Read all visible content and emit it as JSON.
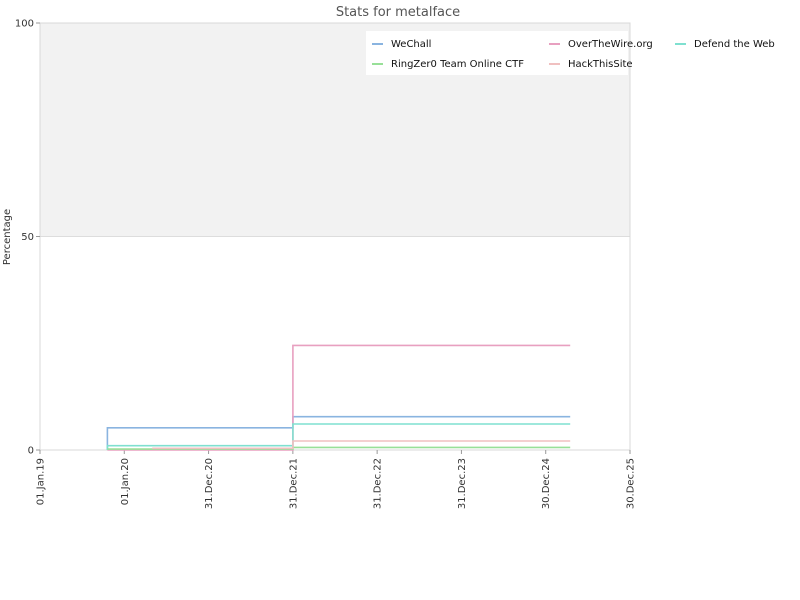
{
  "chart_data": {
    "type": "line",
    "title": "Stats for metalface",
    "ylabel": "Percentage",
    "xlabel": "",
    "ylim": [
      0,
      100
    ],
    "xlim": [
      "2019-01-01",
      "2025-12-30"
    ],
    "y_ticks": [
      0,
      50,
      100
    ],
    "x_ticks": [
      {
        "date": "2019-01-01",
        "label": "01.Jan.19"
      },
      {
        "date": "2020-01-01",
        "label": "01.Jan.20"
      },
      {
        "date": "2020-12-31",
        "label": "31.Dec.20"
      },
      {
        "date": "2021-12-31",
        "label": "31.Dec.21"
      },
      {
        "date": "2022-12-31",
        "label": "31.Dec.22"
      },
      {
        "date": "2023-12-31",
        "label": "31.Dec.23"
      },
      {
        "date": "2024-12-30",
        "label": "30.Dec.24"
      },
      {
        "date": "2025-12-30",
        "label": "30.Dec.25"
      }
    ],
    "step": true,
    "grid": false,
    "shaded_band": [
      50,
      100
    ],
    "legend_position": "top-right",
    "series": [
      {
        "name": "WeChall",
        "color": "#8ab4e0",
        "points": [
          [
            "2019-10-20",
            0
          ],
          [
            "2019-10-20",
            5.2
          ],
          [
            "2021-12-31",
            5.2
          ],
          [
            "2021-12-31",
            7.8
          ],
          [
            "2025-04-15",
            7.8
          ]
        ]
      },
      {
        "name": "OverTheWire.org",
        "color": "#e8a0c0",
        "points": [
          [
            "2019-10-20",
            0
          ],
          [
            "2021-12-31",
            0
          ],
          [
            "2021-12-31",
            24.5
          ],
          [
            "2025-04-15",
            24.5
          ]
        ]
      },
      {
        "name": "Defend the Web",
        "color": "#7fe0d0",
        "points": [
          [
            "2019-10-20",
            0
          ],
          [
            "2019-10-20",
            1.0
          ],
          [
            "2021-12-31",
            1.0
          ],
          [
            "2021-12-31",
            6.1
          ],
          [
            "2025-04-15",
            6.1
          ]
        ]
      },
      {
        "name": "RingZer0 Team Online CTF",
        "color": "#98e098",
        "points": [
          [
            "2019-10-20",
            0.2
          ],
          [
            "2021-12-31",
            0.2
          ],
          [
            "2021-12-31",
            0.6
          ],
          [
            "2025-04-15",
            0.6
          ]
        ]
      },
      {
        "name": "HackThisSite",
        "color": "#f0c0c0",
        "points": [
          [
            "2020-05-01",
            0.4
          ],
          [
            "2021-12-31",
            0.4
          ],
          [
            "2021-12-31",
            2.1
          ],
          [
            "2025-04-15",
            2.1
          ]
        ]
      }
    ]
  }
}
